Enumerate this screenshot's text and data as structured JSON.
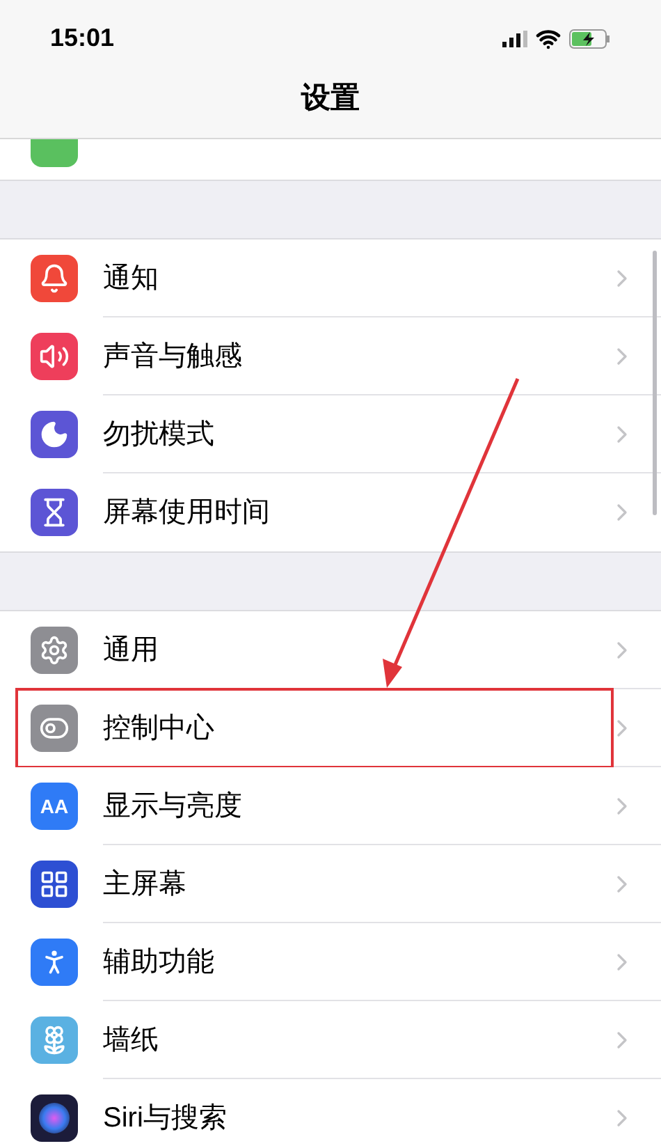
{
  "status_bar": {
    "time": "15:01"
  },
  "nav": {
    "title": "设置"
  },
  "groups": [
    {
      "items": [
        {
          "kind": "notifications",
          "label": "通知",
          "highlighted": false
        },
        {
          "kind": "sounds",
          "label": "声音与触感",
          "highlighted": false
        },
        {
          "kind": "focus",
          "label": "勿扰模式",
          "highlighted": false
        },
        {
          "kind": "screen_time",
          "label": "屏幕使用时间",
          "highlighted": false
        }
      ]
    },
    {
      "items": [
        {
          "kind": "general",
          "label": "通用",
          "highlighted": false
        },
        {
          "kind": "control_center",
          "label": "控制中心",
          "highlighted": true
        },
        {
          "kind": "display",
          "label": "显示与亮度",
          "icon_text": "AA",
          "highlighted": false
        },
        {
          "kind": "home_screen",
          "label": "主屏幕",
          "highlighted": false
        },
        {
          "kind": "accessibility",
          "label": "辅助功能",
          "highlighted": false
        },
        {
          "kind": "wallpaper",
          "label": "墙纸",
          "highlighted": false
        },
        {
          "kind": "siri",
          "label": "Siri与搜索",
          "highlighted": false
        }
      ]
    }
  ]
}
